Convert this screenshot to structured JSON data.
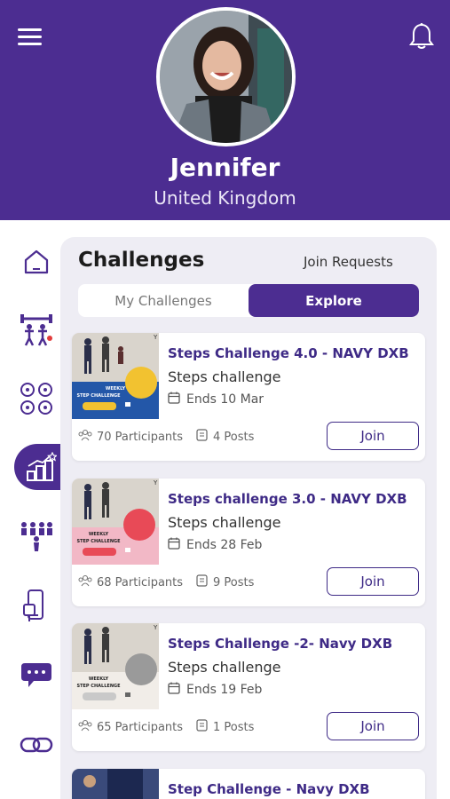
{
  "profile": {
    "name": "Jennifer",
    "country": "United Kingdom"
  },
  "section": {
    "title": "Challenges",
    "join_requests": "Join Requests"
  },
  "tabs": [
    {
      "label": "My Challenges",
      "active": false
    },
    {
      "label": "Explore",
      "active": true
    }
  ],
  "challenges": [
    {
      "title": "Steps Challenge 4.0 - NAVY DXB",
      "subtitle": "Steps challenge",
      "ends": "Ends 10 Mar",
      "participants": "70 Participants",
      "posts": "4 Posts",
      "join_label": "Join",
      "thumb_text": "WEEKLY STEP CHALLENGE",
      "thumb_prize": "Winning Prize Navy Backpack"
    },
    {
      "title": "Steps challenge 3.0 - NAVY DXB",
      "subtitle": "Steps challenge",
      "ends": "Ends 28 Feb",
      "participants": "68 Participants",
      "posts": "9 Posts",
      "join_label": "Join",
      "thumb_text": "WEEKLY STEP CHALLENGE",
      "thumb_prize": "Winning Prize Navy Backpack"
    },
    {
      "title": "Steps Challenge -2- Navy DXB",
      "subtitle": "Steps challenge",
      "ends": "Ends 19 Feb",
      "participants": "65 Participants",
      "posts": "1 Posts",
      "join_label": "Join",
      "thumb_text": "WEEKLY STEP CHALLENGE",
      "thumb_prize": "Winning Prize Navy Backpack"
    },
    {
      "title": "Step Challenge - Navy DXB"
    }
  ],
  "colors": {
    "brand": "#4c2d91",
    "title_text": "#3e2a86",
    "panel_bg": "#eeedf4"
  },
  "icons": {
    "menu": "hamburger-icon",
    "notifications": "bell-icon",
    "sidebar": [
      "home-icon",
      "fitness-icon",
      "activities-icon",
      "challenges-icon",
      "team-icon",
      "device-icon",
      "chat-icon",
      "link-icon"
    ]
  }
}
